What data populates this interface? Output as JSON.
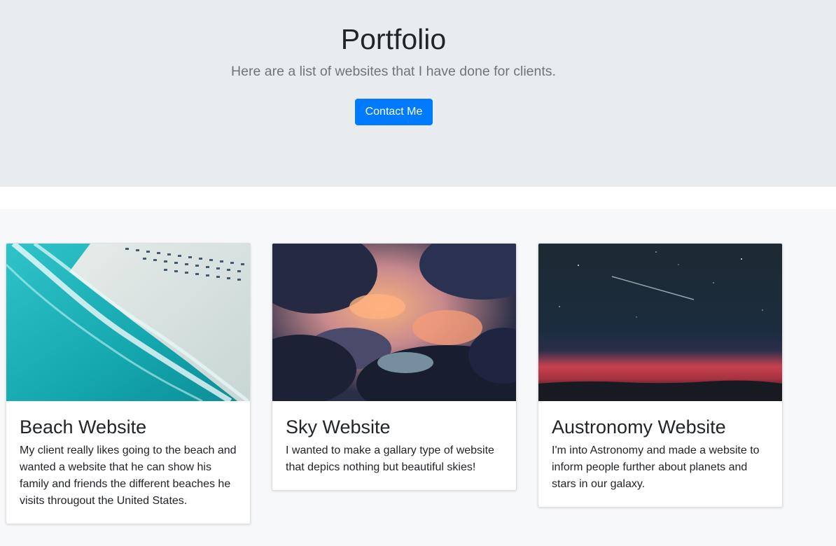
{
  "hero": {
    "title": "Portfolio",
    "subtitle": "Here are a list of websites that I have done for clients.",
    "button_label": "Contact Me"
  },
  "cards": [
    {
      "image": "beach-aerial-photo",
      "title": "Beach Website",
      "text": "My client really likes going to the beach and wanted a website that he can show his family and friends the different beaches he visits througout the United States."
    },
    {
      "image": "sunset-clouds-photo",
      "title": "Sky Website",
      "text": "I wanted to make a gallary type of website that depics nothing but beautiful skies!"
    },
    {
      "image": "night-sky-photo",
      "title": "Austronomy Website",
      "text": "I'm into Astronomy and made a website to inform people further about planets and stars in our galaxy."
    }
  ],
  "colors": {
    "hero_bg": "#e9ecef",
    "primary": "#007bff",
    "muted_text": "#6c757d",
    "album_bg": "#f7f8f9"
  }
}
